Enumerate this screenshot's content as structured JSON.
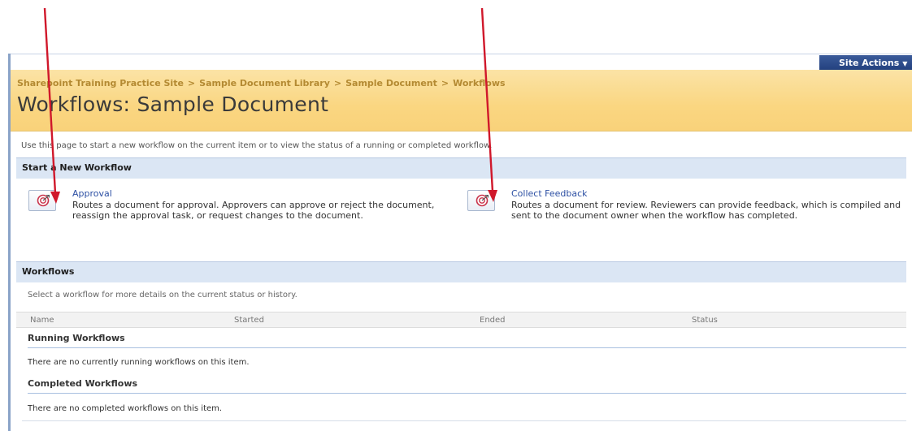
{
  "header": {
    "site_actions": "Site Actions",
    "breadcrumb": [
      "Sharepoint Training Practice Site",
      "Sample Document Library",
      "Sample Document",
      "Workflows"
    ],
    "breadcrumb_separator": ">",
    "title": "Workflows: Sample Document"
  },
  "intro": "Use this page to start a new workflow on the current item or to view the status of a running or completed workflow.",
  "start_section": {
    "heading": "Start a New Workflow",
    "items": [
      {
        "name": "Approval",
        "description": "Routes a document for approval. Approvers can approve or reject the document, reassign the approval task, or request changes to the document.",
        "icon": "workflow-icon"
      },
      {
        "name": "Collect Feedback",
        "description": "Routes a document for review. Reviewers can provide feedback, which is compiled and sent to the document owner when the workflow has completed.",
        "icon": "workflow-icon"
      }
    ]
  },
  "workflows_section": {
    "heading": "Workflows",
    "description": "Select a workflow for more details on the current status or history.",
    "columns": [
      "Name",
      "Started",
      "Ended",
      "Status"
    ],
    "running": {
      "title": "Running Workflows",
      "empty": "There are no currently running workflows on this item."
    },
    "completed": {
      "title": "Completed Workflows",
      "empty": "There are no completed workflows on this item."
    }
  },
  "colors": {
    "title_band": "#fad681",
    "section_header": "#dbe6f4",
    "link": "#2c4fa3",
    "annotation_arrow": "#d0182b"
  }
}
